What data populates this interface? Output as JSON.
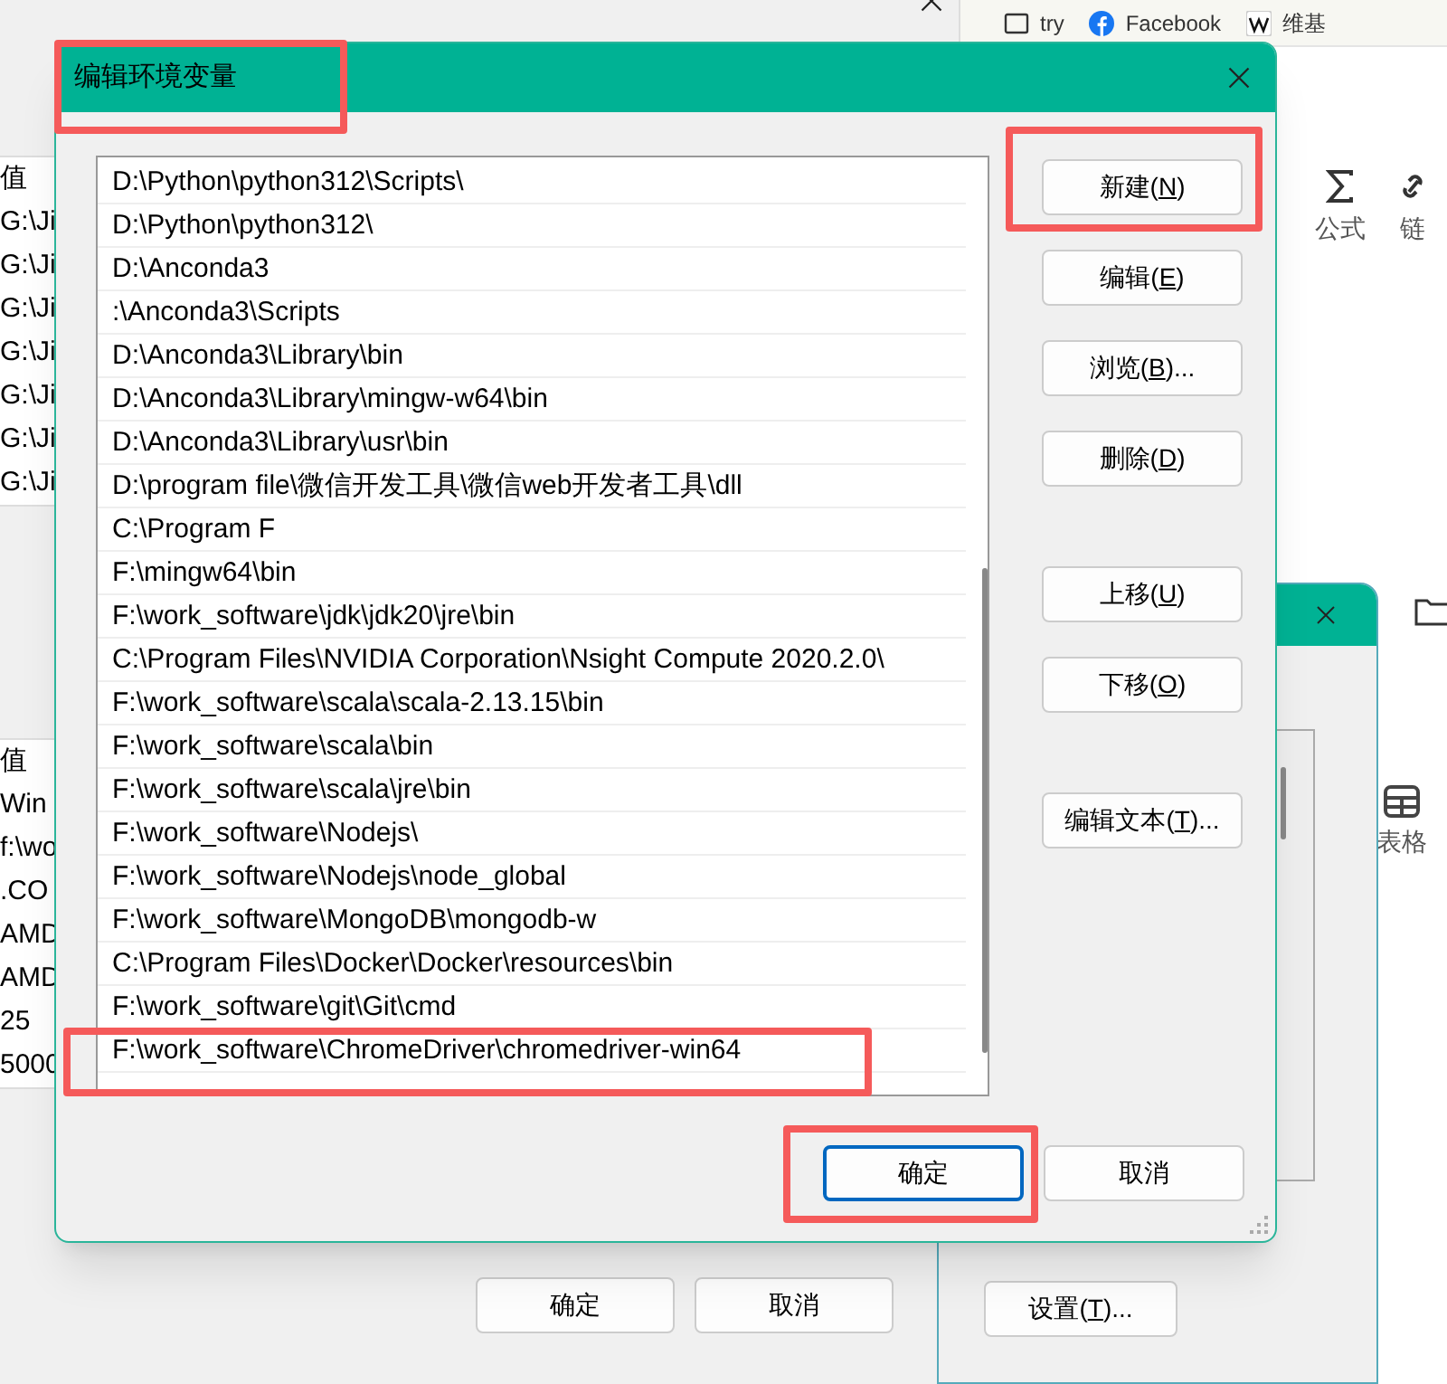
{
  "left_window": {
    "lists": [
      {
        "header": "值",
        "rows": [
          "G:\\Ji",
          "G:\\Ji",
          "G:\\Ji",
          "G:\\Ji",
          "G:\\Ji",
          "G:\\Ji",
          "G:\\Ji"
        ]
      },
      {
        "header": "值",
        "rows": [
          "Win",
          "f:\\wo",
          ".CO",
          "AMD",
          "AMD",
          "25",
          "5000"
        ]
      }
    ],
    "buttons": [
      "确定",
      "取消"
    ]
  },
  "browser": {
    "bookmarks": [
      {
        "label": "try",
        "kind": "folder"
      },
      {
        "label": "Facebook",
        "kind": "facebook"
      },
      {
        "label": "维基",
        "kind": "wiki"
      }
    ],
    "ribbon": [
      {
        "label": "公式",
        "kind": "sigma"
      },
      {
        "label": "链",
        "kind": "link"
      }
    ],
    "side_tool": {
      "label": "表格"
    }
  },
  "settings_dialog": {
    "button": "设置(T)..."
  },
  "dialog": {
    "title": "编辑环境变量",
    "paths": [
      "D:\\Python\\python312\\Scripts\\",
      "D:\\Python\\python312\\",
      "D:\\Anconda3",
      ":\\Anconda3\\Scripts",
      "D:\\Anconda3\\Library\\bin",
      "D:\\Anconda3\\Library\\mingw-w64\\bin",
      "D:\\Anconda3\\Library\\usr\\bin",
      "D:\\program file\\微信开发工具\\微信web开发者工具\\dll",
      "C:\\Program F",
      "F:\\mingw64\\bin",
      "F:\\work_software\\jdk\\jdk20\\jre\\bin",
      "C:\\Program Files\\NVIDIA Corporation\\Nsight Compute 2020.2.0\\",
      "F:\\work_software\\scala\\scala-2.13.15\\bin",
      "F:\\work_software\\scala\\bin",
      "F:\\work_software\\scala\\jre\\bin",
      "F:\\work_software\\Nodejs\\",
      "F:\\work_software\\Nodejs\\node_global",
      "F:\\work_software\\MongoDB\\mongodb-w",
      "C:\\Program Files\\Docker\\Docker\\resources\\bin",
      "F:\\work_software\\git\\Git\\cmd",
      "F:\\work_software\\ChromeDriver\\chromedriver-win64"
    ],
    "side_buttons": [
      "新建(N)",
      "编辑(E)",
      "浏览(B)...",
      "删除(D)",
      "上移(U)",
      "下移(O)",
      "编辑文本(T)..."
    ],
    "footer_buttons": [
      {
        "label": "确定",
        "default": true
      },
      {
        "label": "取消",
        "default": false
      }
    ]
  }
}
